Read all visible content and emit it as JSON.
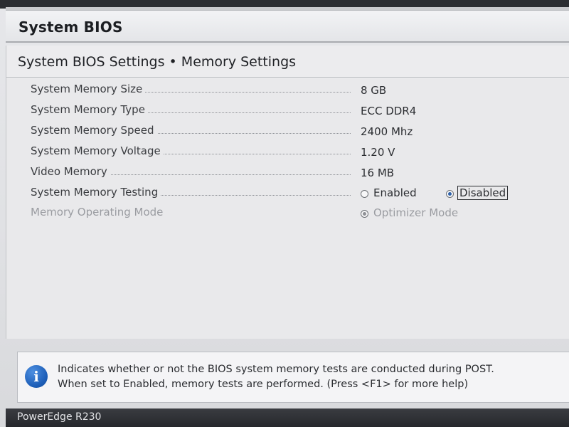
{
  "header": {
    "title": "System BIOS"
  },
  "breadcrumb": "System BIOS Settings • Memory Settings",
  "settings": [
    {
      "label": "System Memory Size",
      "value": "8 GB"
    },
    {
      "label": "System Memory Type",
      "value": "ECC DDR4"
    },
    {
      "label": "System Memory Speed",
      "value": "2400 Mhz"
    },
    {
      "label": "System Memory Voltage",
      "value": "1.20 V"
    },
    {
      "label": "Video Memory",
      "value": "16 MB"
    },
    {
      "label": "System Memory Testing",
      "options": [
        {
          "label": "Enabled",
          "selected": false
        },
        {
          "label": "Disabled",
          "selected": true
        }
      ]
    },
    {
      "label": "Memory Operating Mode",
      "disabled": true,
      "options": [
        {
          "label": "Optimizer Mode",
          "selected": true
        }
      ]
    }
  ],
  "help": {
    "icon": "info-icon",
    "line1": "Indicates whether or not the BIOS system memory tests are conducted during POST.",
    "line2": "When set to Enabled, memory tests are performed. (Press <F1> for more help)"
  },
  "footer": {
    "model": "PowerEdge R230"
  },
  "colors": {
    "accent": "#2f61a8",
    "footer_bg": "#26282c",
    "info_icon": "#1d5eb8"
  }
}
